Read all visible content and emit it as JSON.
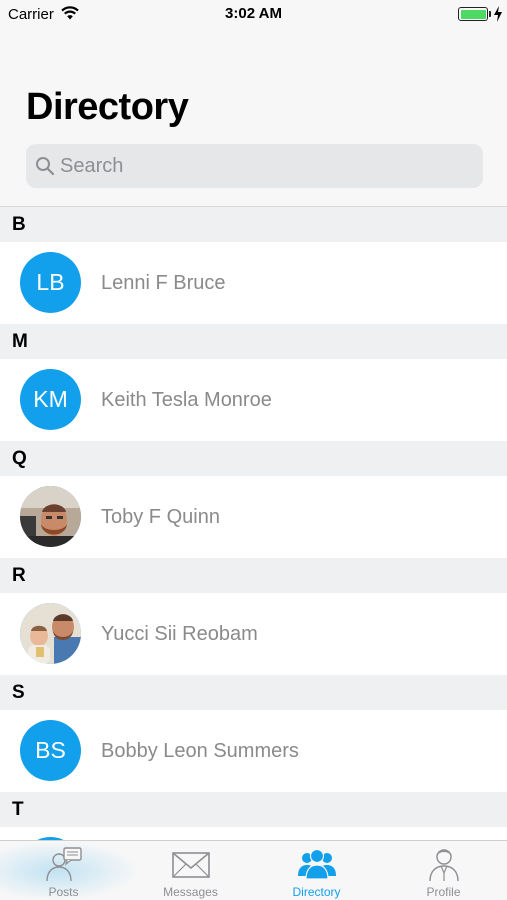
{
  "status_bar": {
    "carrier": "Carrier",
    "time": "3:02 AM",
    "battery_level": 1.0,
    "battery_color": "#4cd964"
  },
  "header": {
    "title": "Directory",
    "search_placeholder": "Search",
    "search_value": ""
  },
  "theme": {
    "accent": "#12a0ec",
    "section_bg": "#eff0f2",
    "name_color": "#8a8a8a"
  },
  "sections": [
    {
      "letter": "B",
      "contacts": [
        {
          "name": "Lenni F Bruce",
          "initials": "LB",
          "avatar": "initials"
        }
      ]
    },
    {
      "letter": "M",
      "contacts": [
        {
          "name": "Keith Tesla Monroe",
          "initials": "KM",
          "avatar": "initials"
        }
      ]
    },
    {
      "letter": "Q",
      "contacts": [
        {
          "name": "Toby F Quinn",
          "initials": "",
          "avatar": "photo"
        }
      ]
    },
    {
      "letter": "R",
      "contacts": [
        {
          "name": "Yucci Sii Reobam",
          "initials": "",
          "avatar": "photo"
        }
      ]
    },
    {
      "letter": "S",
      "contacts": [
        {
          "name": "Bobby Leon Summers",
          "initials": "BS",
          "avatar": "initials"
        }
      ]
    },
    {
      "letter": "T",
      "contacts": [
        {
          "name": "",
          "initials": "",
          "avatar": "initials"
        }
      ]
    }
  ],
  "tabs": [
    {
      "label": "Posts",
      "icon": "posts-icon",
      "active": false
    },
    {
      "label": "Messages",
      "icon": "envelope-icon",
      "active": false
    },
    {
      "label": "Directory",
      "icon": "people-icon",
      "active": true
    },
    {
      "label": "Profile",
      "icon": "person-icon",
      "active": false
    }
  ]
}
